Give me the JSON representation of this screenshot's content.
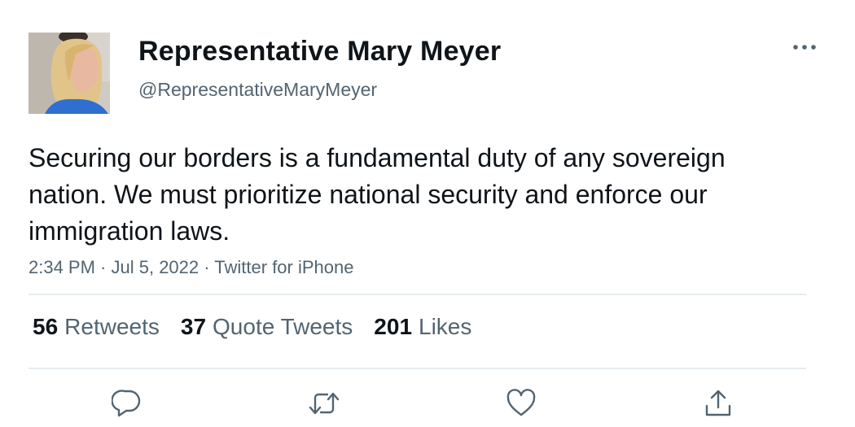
{
  "user": {
    "display_name": "Representative Mary Meyer",
    "handle": "@RepresentativeMaryMeyer",
    "avatar_icon": "profile-photo"
  },
  "tweet": {
    "text": "Securing our borders is a fundamental duty of any sovereign nation. We must prioritize national security and enforce our immigration laws.",
    "time": "2:34 PM",
    "date": "Jul 5, 2022",
    "source": "Twitter for iPhone",
    "separator": " · "
  },
  "stats": {
    "retweets": {
      "count": "56",
      "label": "Retweets"
    },
    "quote_tweets": {
      "count": "37",
      "label": "Quote Tweets"
    },
    "likes": {
      "count": "201",
      "label": "Likes"
    }
  },
  "actions": {
    "reply_icon": "reply-icon",
    "retweet_icon": "retweet-icon",
    "like_icon": "heart-icon",
    "share_icon": "share-icon"
  },
  "colors": {
    "text_primary": "#0f1419",
    "text_secondary": "#536471",
    "divider": "#e6ecf0"
  }
}
